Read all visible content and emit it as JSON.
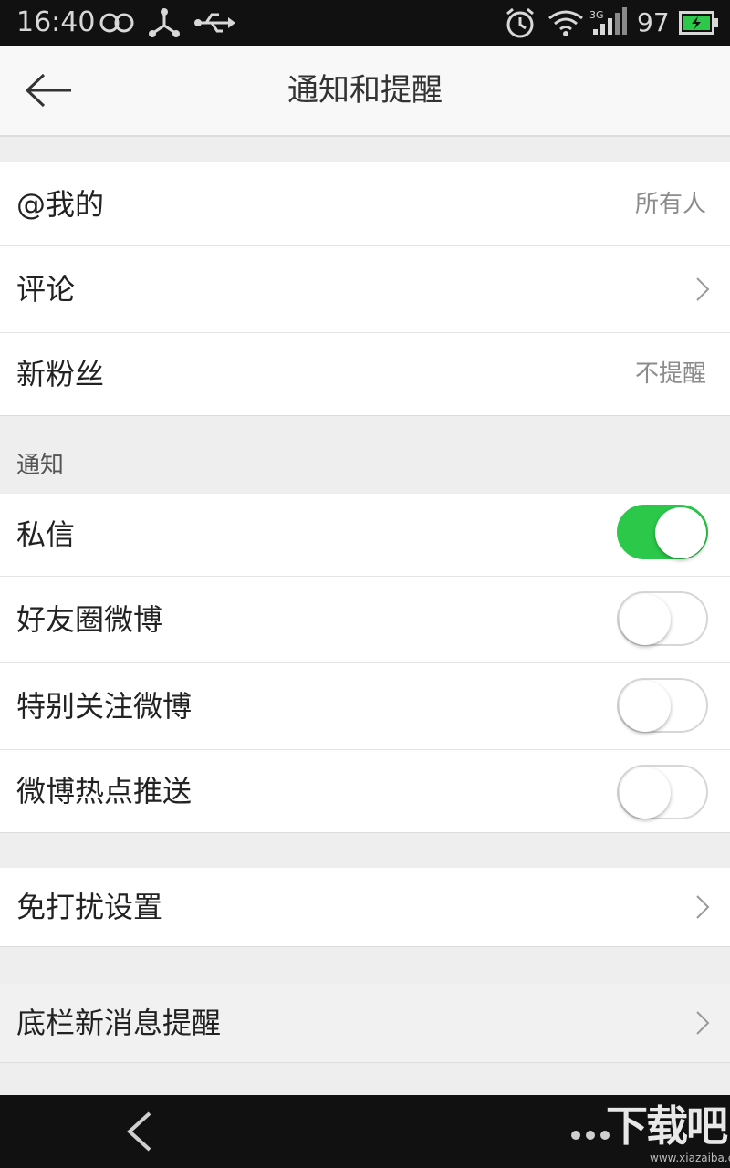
{
  "status_bar": {
    "time": "16:40",
    "battery": "97",
    "icons": [
      "infinity-icon",
      "share-icon",
      "usb-icon",
      "alarm-icon",
      "wifi-icon",
      "signal-3g-icon",
      "battery-charging-icon"
    ],
    "battery_color": "#2bc84a"
  },
  "header": {
    "title": "通知和提醒",
    "back_icon": "back-arrow-icon"
  },
  "group1": {
    "rows": [
      {
        "label": "@我的",
        "value": "所有人"
      },
      {
        "label": "评论",
        "value": ""
      },
      {
        "label": "新粉丝",
        "value": "不提醒"
      }
    ]
  },
  "notifications": {
    "section_label": "通知",
    "rows": [
      {
        "label": "私信",
        "enabled": true
      },
      {
        "label": "好友圈微博",
        "enabled": false
      },
      {
        "label": "特别关注微博",
        "enabled": false
      },
      {
        "label": "微博热点推送",
        "enabled": false
      }
    ]
  },
  "group3": {
    "rows": [
      {
        "label": "免打扰设置"
      }
    ]
  },
  "group4": {
    "rows": [
      {
        "label": "底栏新消息提醒"
      }
    ]
  },
  "colors": {
    "toggle_on": "#2bc84a",
    "background": "#eeeeee"
  },
  "watermark": {
    "text": "下载吧",
    "url": "www.xiazaiba.com"
  }
}
